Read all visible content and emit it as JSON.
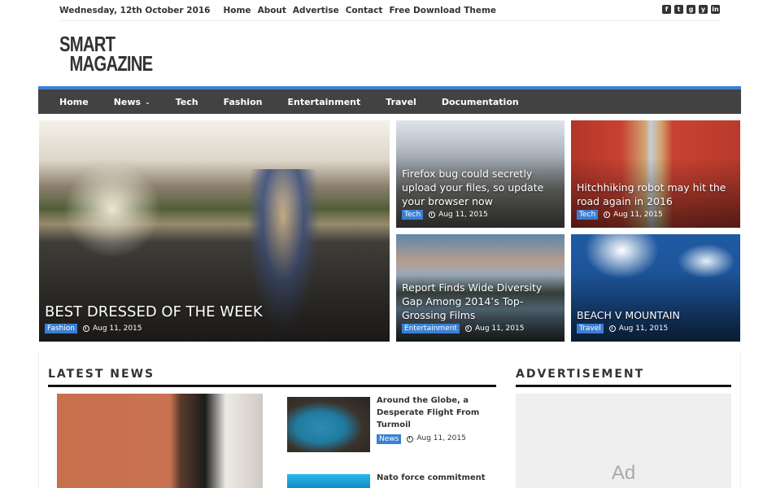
{
  "topbar": {
    "date": "Wednesday, 12th October 2016",
    "links": [
      "Home",
      "About",
      "Advertise",
      "Contact",
      "Free Download Theme"
    ],
    "social": [
      {
        "icon": "facebook-icon",
        "glyph": "f"
      },
      {
        "icon": "twitter-icon",
        "glyph": "t"
      },
      {
        "icon": "google-plus-icon",
        "glyph": "g"
      },
      {
        "icon": "youtube-icon",
        "glyph": "y"
      },
      {
        "icon": "linkedin-icon",
        "glyph": "in"
      }
    ]
  },
  "logo": {
    "line1": "SMART",
    "line2": "MAGAZINE"
  },
  "nav": {
    "items": [
      "Home",
      "News",
      "Tech",
      "Fashion",
      "Entertainment",
      "Travel",
      "Documentation"
    ],
    "dropdown_glyph": "⌄"
  },
  "colors": {
    "accent": "#3b7fd4",
    "nav_bg": "#424242"
  },
  "featured": [
    {
      "title": "BEST DRESSED OF THE WEEK",
      "category": "Fashion",
      "date": "Aug 11, 2015"
    },
    {
      "title": "Firefox bug could secretly upload your files, so update your browser now",
      "category": "Tech",
      "date": "Aug 11, 2015"
    },
    {
      "title": "Hitchhiking robot may hit the road again in 2016",
      "category": "Tech",
      "date": "Aug 11, 2015"
    },
    {
      "title": "Report Finds Wide Diversity Gap Among 2014’s Top-Grossing Films",
      "category": "Entertainment",
      "date": "Aug 11, 2015"
    },
    {
      "title": "BEACH V MOUNTAIN",
      "category": "Travel",
      "date": "Aug 11, 2015"
    }
  ],
  "latest": {
    "heading": "LATEST NEWS",
    "items": [
      {
        "title": "Around the Globe, a Desperate Flight From Turmoil",
        "category": "News",
        "date": "Aug 11, 2015"
      },
      {
        "title": "Nato force commitment"
      }
    ]
  },
  "sidebar": {
    "heading": "ADVERTISEMENT",
    "ad_label": "Ad"
  }
}
